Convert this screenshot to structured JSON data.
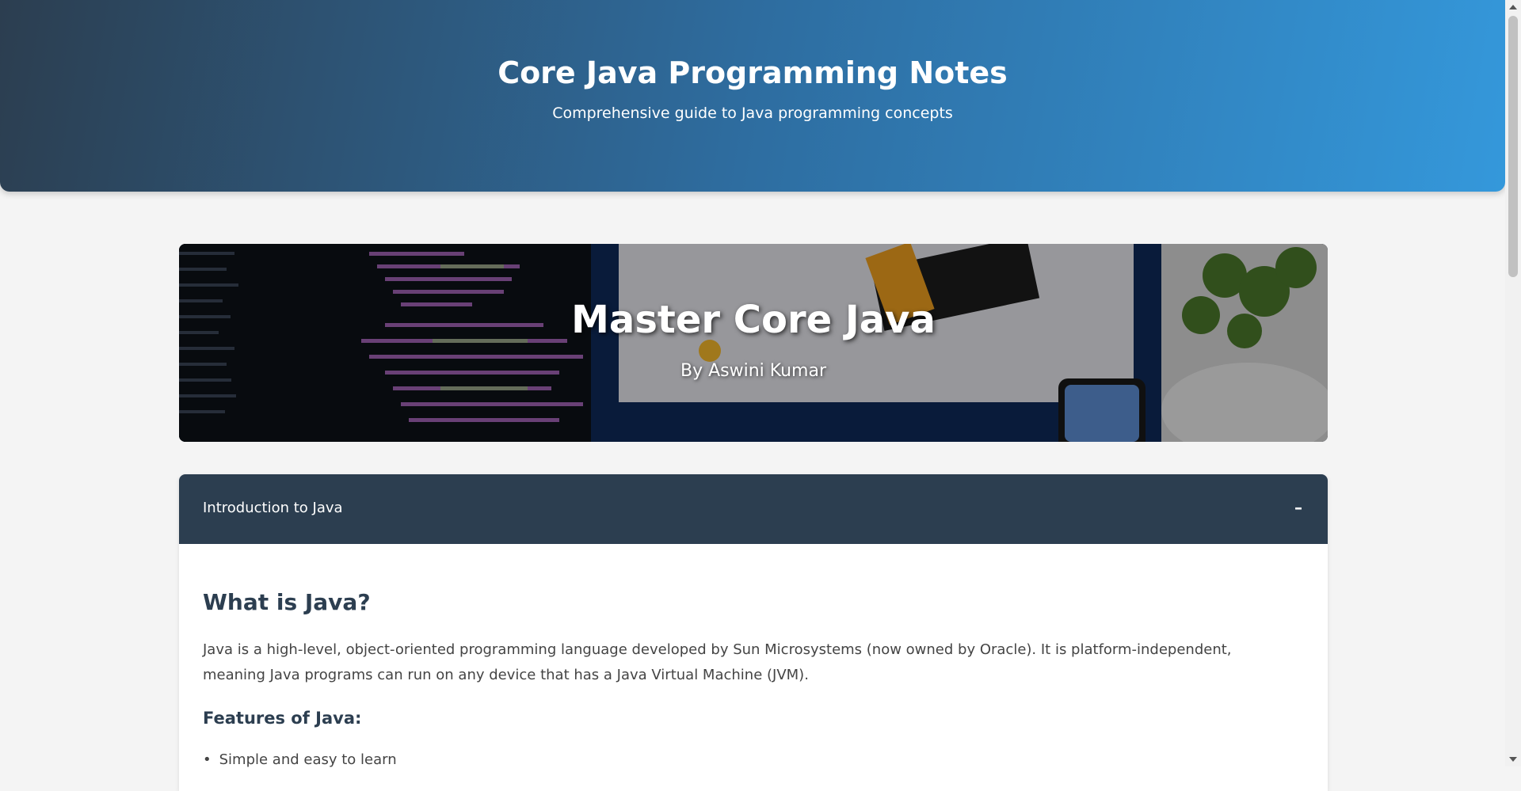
{
  "header": {
    "title": "Core Java Programming Notes",
    "subtitle": "Comprehensive guide to Java programming concepts"
  },
  "hero": {
    "title": "Master Core Java",
    "author": "By Aswini Kumar"
  },
  "section": {
    "title": "Introduction to Java",
    "toggle": "–",
    "heading": "What is Java?",
    "paragraph": "Java is a high-level, object-oriented programming language developed by Sun Microsystems (now owned by Oracle). It is platform-independent, meaning Java programs can run on any device that has a Java Virtual Machine (JVM).",
    "features_heading": "Features of Java:",
    "features": [
      "Simple and easy to learn"
    ]
  },
  "colors": {
    "header_gradient_start": "#2c3e50",
    "header_gradient_end": "#3498db",
    "section_header": "#2c3e50",
    "page_background": "#f4f4f4"
  }
}
